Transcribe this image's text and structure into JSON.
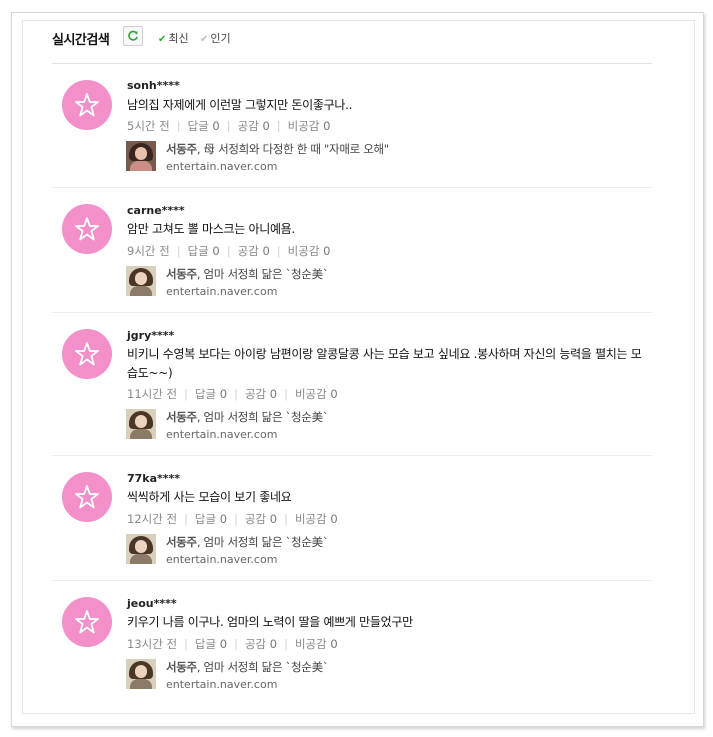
{
  "header": {
    "title": "실시간검색",
    "refresh_icon": "refresh-icon",
    "tabs": [
      {
        "label": "최신",
        "active": true
      },
      {
        "label": "인기",
        "active": false
      }
    ]
  },
  "colors": {
    "avatar": "#f38fc9",
    "active_check": "#2fa83a"
  },
  "labels": {
    "reply": "답글",
    "agree": "공감",
    "disagree": "비공감"
  },
  "comments": [
    {
      "user": "sonh****",
      "text": "남의집 자제에게 이런말 그렇지만 돈이좋구나..",
      "time": "5시간 전",
      "replies": "0",
      "agree": "0",
      "disagree": "0",
      "news": {
        "name": "서동주",
        "title": ", 母 서정희와 다정한 한 때 \"자매로 오해\"",
        "domain": "entertain.naver.com"
      }
    },
    {
      "user": "carne****",
      "text": "암만 고쳐도 뽈 마스크는 아니예욤.",
      "time": "9시간 전",
      "replies": "0",
      "agree": "0",
      "disagree": "0",
      "news": {
        "name": "서동주",
        "title": ", 엄마 서정희 닮은 `청순美`",
        "domain": "entertain.naver.com"
      }
    },
    {
      "user": "jgry****",
      "text": "비키니 수영복 보다는 아이랑 남편이랑 알콩달콩 사는 모습 보고 싶네요 .봉사하며 자신의 능력을 펼치는 모습도~~)",
      "time": "11시간 전",
      "replies": "0",
      "agree": "0",
      "disagree": "0",
      "news": {
        "name": "서동주",
        "title": ", 엄마 서정희 닮은 `청순美`",
        "domain": "entertain.naver.com"
      }
    },
    {
      "user": "77ka****",
      "text": "씩씩하게 사는 모습이 보기 좋네요",
      "time": "12시간 전",
      "replies": "0",
      "agree": "0",
      "disagree": "0",
      "news": {
        "name": "서동주",
        "title": ", 엄마 서정희 닮은 `청순美`",
        "domain": "entertain.naver.com"
      }
    },
    {
      "user": "jeou****",
      "text": "키우기 나름 이구나. 엄마의 노력이 딸을 예쁘게 만들었구만",
      "time": "13시간 전",
      "replies": "0",
      "agree": "0",
      "disagree": "0",
      "news": {
        "name": "서동주",
        "title": ", 엄마 서정희 닮은 `청순美`",
        "domain": "entertain.naver.com"
      }
    }
  ]
}
